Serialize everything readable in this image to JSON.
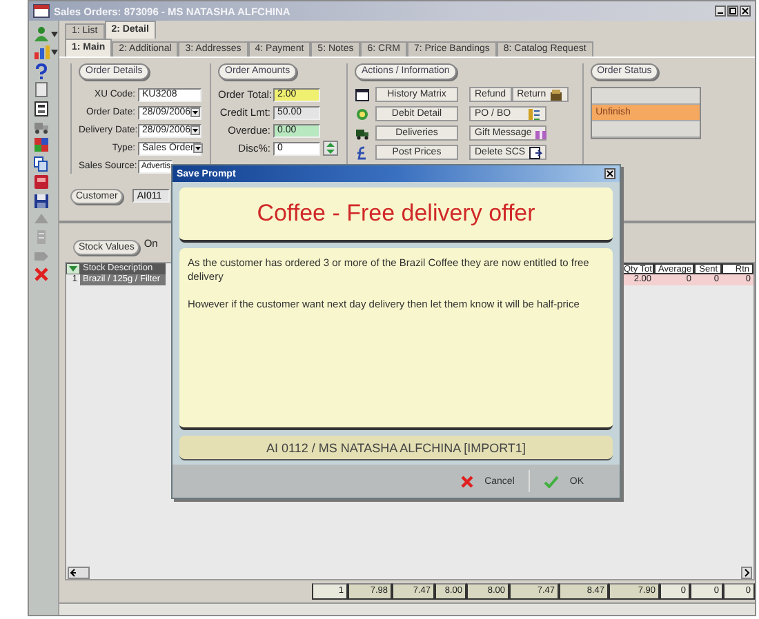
{
  "window": {
    "title": "Sales Orders: 873096 - MS NATASHA ALFCHINA"
  },
  "view_tabs": [
    {
      "label": "1: List",
      "selected": false
    },
    {
      "label": "2: Detail",
      "selected": true
    }
  ],
  "detail_tabs": [
    {
      "label": "1: Main",
      "selected": true
    },
    {
      "label": "2: Additional",
      "selected": false
    },
    {
      "label": "3: Addresses",
      "selected": false
    },
    {
      "label": "4: Payment",
      "selected": false
    },
    {
      "label": "5: Notes",
      "selected": false
    },
    {
      "label": "6: CRM",
      "selected": false
    },
    {
      "label": "7: Price Bandings",
      "selected": false
    },
    {
      "label": "8: Catalog Request",
      "selected": false
    }
  ],
  "order_details": {
    "title": "Order Details",
    "fields": [
      {
        "label": "XU Code:",
        "value": "KU3208",
        "kind": "text"
      },
      {
        "label": "Order Date:",
        "value": "28/09/2006",
        "kind": "dropdown"
      },
      {
        "label": "Delivery Date:",
        "value": "28/09/2006",
        "kind": "dropdown"
      },
      {
        "label": "Type:",
        "value": "Sales Order",
        "kind": "dropdown"
      },
      {
        "label": "Sales Source:",
        "value": "Advertis",
        "kind": "text"
      }
    ]
  },
  "customer": {
    "button": "Customer",
    "value": "AI011"
  },
  "order_amounts": {
    "title": "Order Amounts",
    "fields": [
      {
        "label": "Order Total:",
        "value": "2.00",
        "kind": "text",
        "color": "#f0f070"
      },
      {
        "label": "Credit Lmt:",
        "value": "50.00",
        "kind": "text",
        "color": "#e4e4e4"
      },
      {
        "label": "Overdue:",
        "value": "0.00",
        "kind": "text",
        "color": "#b8e8c0"
      },
      {
        "label": "Disc%:",
        "value": "0",
        "kind": "spin",
        "color": "#ffffff"
      }
    ]
  },
  "actions": {
    "title": "Actions / Information",
    "left_buttons": [
      {
        "label": "History Matrix"
      },
      {
        "label": "Debit Detail"
      },
      {
        "label": "Deliveries"
      },
      {
        "label": "Post Prices"
      }
    ],
    "right_rows": [
      [
        "Refund",
        "Return"
      ],
      [
        "PO / BO"
      ],
      [
        "Gift Message"
      ],
      [
        "Delete SCS"
      ]
    ]
  },
  "order_status": {
    "title": "Order Status",
    "rows": [
      {
        "selected": false
      },
      {
        "label": "Unfinish",
        "selected": true
      },
      {
        "selected": false
      }
    ]
  },
  "stock": {
    "button": "Stock Values",
    "note": "On",
    "left_column": "Stock Description",
    "right_columns": [
      "Qty Tot",
      "Average",
      "Sent",
      "Rtn"
    ],
    "rows": [
      {
        "number": "1",
        "description": "Brazil / 125g / Filter",
        "values": [
          "2.00",
          "0",
          "0",
          "0"
        ],
        "selected": true
      }
    ],
    "totals": [
      "1",
      "7.98",
      "7.47",
      "8.00",
      "8.00",
      "7.47",
      "8.47",
      "7.90",
      "0",
      "0",
      "0"
    ]
  },
  "dialog": {
    "title": "Save Prompt",
    "heading": "Coffee - Free delivery offer",
    "paragraphs": [
      "As the customer has ordered 3 or more of the Brazil Coffee they are now entitled to free delivery",
      "However if the customer want next day delivery then let them know it will be half-price"
    ],
    "footer": "AI 0112 / MS NATASHA ALFCHINA [IMPORT1]",
    "buttons": [
      {
        "label": "Cancel",
        "kind": "cancel"
      },
      {
        "label": "OK",
        "kind": "ok"
      }
    ]
  }
}
